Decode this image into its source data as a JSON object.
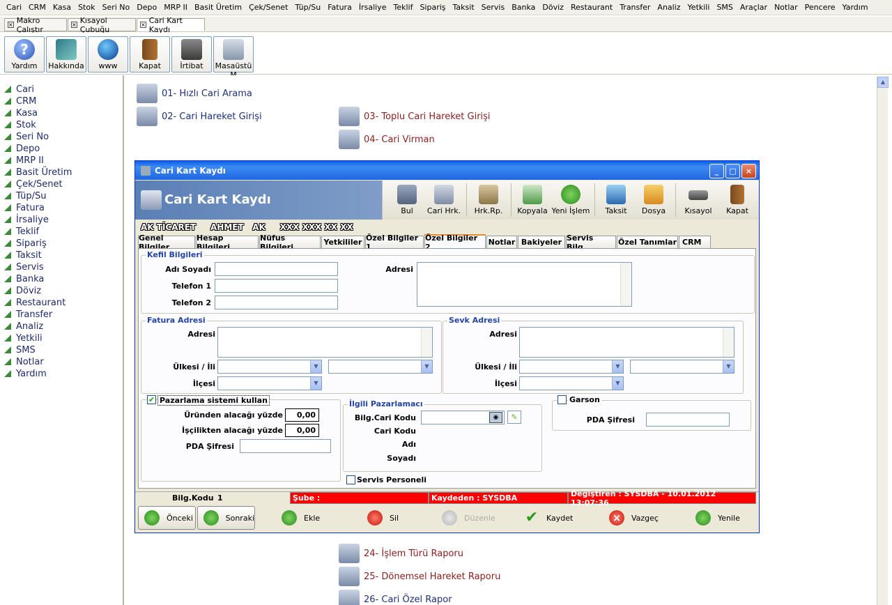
{
  "menu": [
    "Cari",
    "CRM",
    "Kasa",
    "Stok",
    "Seri No",
    "Depo",
    "MRP II",
    "Basit Üretim",
    "Çek/Senet",
    "Tüp/Su",
    "Fatura",
    "İrsaliye",
    "Teklif",
    "Sipariş",
    "Taksit",
    "Servis",
    "Banka",
    "Döviz",
    "Restaurant",
    "Transfer",
    "Analiz",
    "Yetkili",
    "SMS",
    "Araçlar",
    "Notlar",
    "Pencere",
    "Yardım"
  ],
  "window_tabs": [
    "Makro Çalıştır",
    "Kısayol Çubuğu",
    "Cari Kart Kaydı"
  ],
  "toolbar": [
    "Yardım",
    "Hakkında",
    "www",
    "Kapat",
    "İrtibat",
    "Masaüstü M"
  ],
  "sidebar": [
    "Cari",
    "CRM",
    "Kasa",
    "Stok",
    "Seri No",
    "Depo",
    "MRP II",
    "Basit Üretim",
    "Çek/Senet",
    "Tüp/Su",
    "Fatura",
    "İrsaliye",
    "Teklif",
    "Sipariş",
    "Taksit",
    "Servis",
    "Banka",
    "Döviz",
    "Restaurant",
    "Transfer",
    "Analiz",
    "Yetkili",
    "SMS",
    "Notlar",
    "Yardım"
  ],
  "bg_items": [
    "01- Hızlı Cari Arama",
    "02- Cari Hareket Girişi",
    "03- Toplu Cari Hareket Girişi",
    "04- Cari Virman",
    "24- İşlem Türü Raporu",
    "25- Dönemsel Hareket Raporu",
    "26- Cari Özel Rapor"
  ],
  "dialog": {
    "title": "Cari Kart Kaydı",
    "header_title": "Cari Kart Kaydı",
    "tools": [
      "Bul",
      "Cari Hrk.",
      "Hrk.Rp.",
      "Kopyala",
      "Yeni İşlem",
      "Taksit",
      "Dosya",
      "Kısayol",
      "Kapat"
    ],
    "header_line": "AK TİCARET     AHMET   AK     XXX XXX XX XX",
    "tabs": [
      "Genel Bilgiler",
      "Hesap Bilgileri",
      "Nüfus Bilgileri",
      "Yetkililer",
      "Özel Bilgiler 1",
      "Özel Bilgiler 2",
      "Notlar",
      "Bakiyeler",
      "Servis Bilg.",
      "Özel Tanımlar",
      "CRM"
    ],
    "kefil": {
      "group": "Kefil Bilgileri",
      "adi": "Adı Soyadı",
      "tel1": "Telefon 1",
      "tel2": "Telefon 2",
      "adres": "Adresi"
    },
    "fatura": {
      "group": "Fatura Adresi",
      "adres": "Adresi",
      "ulke": "Ülkesi / İli",
      "ilce": "İlçesi"
    },
    "sevk": {
      "group": "Sevk Adresi",
      "adres": "Adresi",
      "ulke": "Ülkesi / İli",
      "ilce": "İlçesi"
    },
    "pazarlama": {
      "check": "Pazarlama sistemi kullan",
      "urun": "Üründen alacağı yüzde",
      "urun_val": "0,00",
      "iscilik": "İşçilikten alacağı yüzde",
      "iscilik_val": "0,00",
      "pda": "PDA Şifresi"
    },
    "ilgili": {
      "group": "İlgili Pazarlamacı",
      "bilg": "Bilg.Cari Kodu",
      "cari": "Cari Kodu",
      "adi": "Adı",
      "soyadi": "Soyadı",
      "servis": "Servis Personeli"
    },
    "garson": {
      "check": "Garson",
      "pda": "PDA Şifresi"
    },
    "status": {
      "bilg": "Bilg.Kodu",
      "bilg_val": "1",
      "sube": "Şube :",
      "kaydeden": "Kaydeden : SYSDBA",
      "degistiren": "Değiştiren : SYSDBA - 10.01.2012 13:07:36"
    },
    "footer": [
      "Önceki",
      "Sonraki",
      "Ekle",
      "Sil",
      "Düzenle",
      "Kaydet",
      "Vazgeç",
      "Yenile"
    ]
  }
}
